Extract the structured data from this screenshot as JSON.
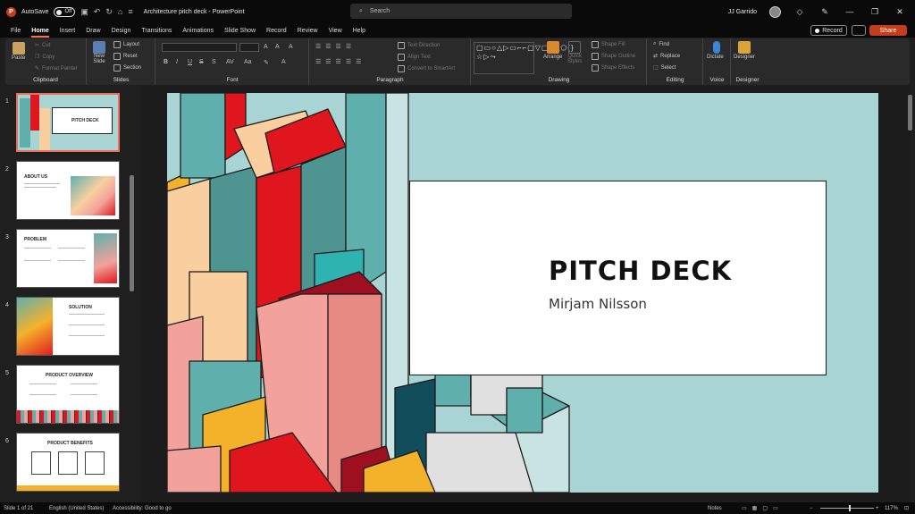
{
  "titlebar": {
    "autosave": "AutoSave",
    "toggle": "Off",
    "doc_title": "Architecture pitch deck",
    "app": "PowerPoint",
    "separator": " - ",
    "search_placeholder": "Search",
    "user": "JJ Garrido"
  },
  "menu": {
    "tabs": [
      "File",
      "Home",
      "Insert",
      "Draw",
      "Design",
      "Transitions",
      "Animations",
      "Slide Show",
      "Record",
      "Review",
      "View",
      "Help"
    ],
    "record": "Record",
    "share": "Share"
  },
  "ribbon": {
    "clipboard": {
      "label": "Clipboard",
      "paste": "Paste",
      "cut": "Cut",
      "copy": "Copy",
      "format_painter": "Format Painter"
    },
    "slides": {
      "label": "Slides",
      "new_slide": "New",
      "new_slide2": "Slide",
      "layout": "Layout",
      "reset": "Reset",
      "section": "Section"
    },
    "font": {
      "label": "Font",
      "bold": "B",
      "italic": "I",
      "underline": "U",
      "strike": "S"
    },
    "paragraph": {
      "label": "Paragraph",
      "text_direction": "Text Direction",
      "align_text": "Align Text",
      "convert_smartart": "Convert to SmartArt"
    },
    "drawing": {
      "label": "Drawing",
      "arrange": "Arrange",
      "quick_styles": "Quick",
      "quick_styles2": "Styles",
      "shape_fill": "Shape Fill",
      "shape_outline": "Shape Outline",
      "shape_effects": "Shape Effects"
    },
    "editing": {
      "label": "Editing",
      "find": "Find",
      "replace": "Replace",
      "select": "Select"
    },
    "voice": {
      "label": "Voice",
      "dictate": "Dictate"
    },
    "designer": {
      "label": "Designer",
      "designer": "Designer"
    }
  },
  "slides": [
    {
      "num": "1",
      "title": "PITCH DECK"
    },
    {
      "num": "2",
      "title": "ABOUT US"
    },
    {
      "num": "3",
      "title": "PROBLEM"
    },
    {
      "num": "4",
      "title": "SOLUTION"
    },
    {
      "num": "5",
      "title": "PRODUCT OVERVIEW"
    },
    {
      "num": "6",
      "title": "PRODUCT BENEFITS"
    }
  ],
  "current_slide": {
    "title": "PITCH DECK",
    "subtitle": "Mirjam Nilsson"
  },
  "status": {
    "slide_of": "Slide 1 of 21",
    "language": "English (United States)",
    "accessibility": "Accessibility: Good to go",
    "notes": "Notes",
    "zoom": "117%"
  },
  "colors": {
    "accent": "#c43e1c",
    "slide_bg": "#a8d5d3",
    "red": "#e0161e",
    "teal": "#5fb0ad",
    "peach": "#f9cfa0",
    "pink": "#f2a29a",
    "gold": "#f4b22a"
  }
}
